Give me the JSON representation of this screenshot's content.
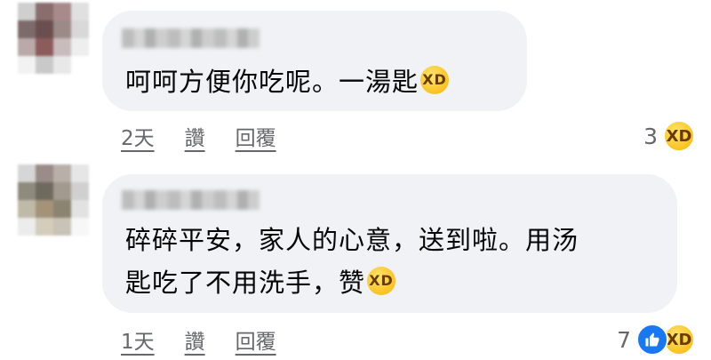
{
  "comments": [
    {
      "text": "呵呵方便你吃呢。一湯匙",
      "emoji": "😂",
      "actions": {
        "time": "2天",
        "like": "讚",
        "reply": "回覆"
      },
      "reactions": {
        "count": "3",
        "icons": [
          "laughing-emoji-icon"
        ]
      }
    },
    {
      "text_line1": "碎碎平安，家人的心意，送到啦。用汤",
      "text_line2": "匙吃了不用洗手，赞",
      "emoji": "🤣",
      "actions": {
        "time": "1天",
        "like": "讚",
        "reply": "回覆"
      },
      "reactions": {
        "count": "7",
        "icons": [
          "like-thumb-icon",
          "laughing-emoji-icon"
        ]
      }
    }
  ],
  "colors": {
    "bubble": "#f0f2f5",
    "meta_text": "#65676b",
    "like_blue": "#1877f2",
    "emoji_yellow": "#f7b500"
  }
}
